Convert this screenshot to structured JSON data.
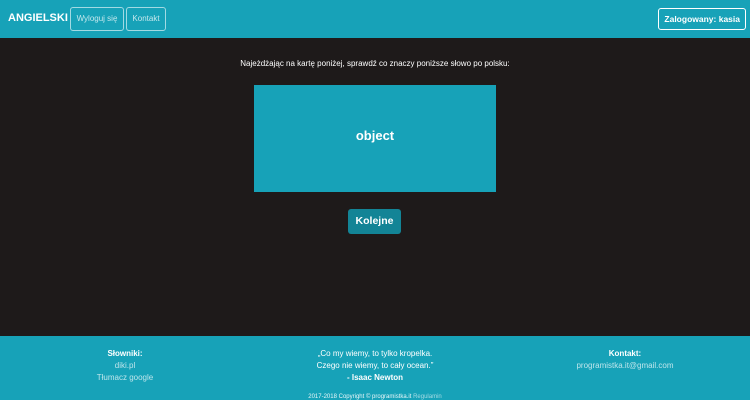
{
  "navbar": {
    "brand": "ANGIELSKI",
    "logout_label": "Wyloguj się",
    "contact_label": "Kontakt",
    "user_label": "Zalogowany: kasia"
  },
  "main": {
    "instruction": "Najeżdżając na kartę poniżej, sprawdź co znaczy poniższe słowo po polsku:",
    "card_word": "object",
    "next_label": "Kolejne"
  },
  "footer": {
    "dictionaries": {
      "heading": "Słowniki:",
      "links": [
        "diki.pl",
        "Tłumacz google"
      ]
    },
    "quote": {
      "line1": "„Co my wiemy, to tylko kropelka.",
      "line2": "Czego nie wiemy, to cały ocean.”",
      "author": "- Isaac Newton"
    },
    "contact": {
      "heading": "Kontakt:",
      "email": "programistka.it@gmail.com"
    },
    "copyright": "2017-2018 Copyright © programistka.it",
    "copyright_link": "Regulamin"
  },
  "colors": {
    "accent": "#17a2b8",
    "button": "#138496",
    "background": "#1e1a1a"
  }
}
